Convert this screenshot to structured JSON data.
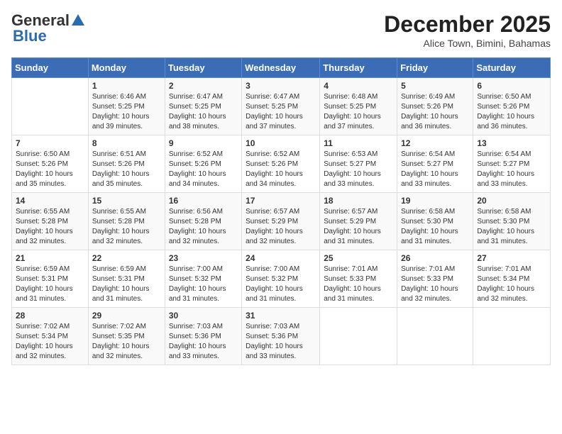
{
  "header": {
    "logo_general": "General",
    "logo_blue": "Blue",
    "month_title": "December 2025",
    "location": "Alice Town, Bimini, Bahamas"
  },
  "weekdays": [
    "Sunday",
    "Monday",
    "Tuesday",
    "Wednesday",
    "Thursday",
    "Friday",
    "Saturday"
  ],
  "weeks": [
    [
      {
        "day": "",
        "sunrise": "",
        "sunset": "",
        "daylight": ""
      },
      {
        "day": "1",
        "sunrise": "Sunrise: 6:46 AM",
        "sunset": "Sunset: 5:25 PM",
        "daylight": "Daylight: 10 hours and 39 minutes."
      },
      {
        "day": "2",
        "sunrise": "Sunrise: 6:47 AM",
        "sunset": "Sunset: 5:25 PM",
        "daylight": "Daylight: 10 hours and 38 minutes."
      },
      {
        "day": "3",
        "sunrise": "Sunrise: 6:47 AM",
        "sunset": "Sunset: 5:25 PM",
        "daylight": "Daylight: 10 hours and 37 minutes."
      },
      {
        "day": "4",
        "sunrise": "Sunrise: 6:48 AM",
        "sunset": "Sunset: 5:25 PM",
        "daylight": "Daylight: 10 hours and 37 minutes."
      },
      {
        "day": "5",
        "sunrise": "Sunrise: 6:49 AM",
        "sunset": "Sunset: 5:26 PM",
        "daylight": "Daylight: 10 hours and 36 minutes."
      },
      {
        "day": "6",
        "sunrise": "Sunrise: 6:50 AM",
        "sunset": "Sunset: 5:26 PM",
        "daylight": "Daylight: 10 hours and 36 minutes."
      }
    ],
    [
      {
        "day": "7",
        "sunrise": "Sunrise: 6:50 AM",
        "sunset": "Sunset: 5:26 PM",
        "daylight": "Daylight: 10 hours and 35 minutes."
      },
      {
        "day": "8",
        "sunrise": "Sunrise: 6:51 AM",
        "sunset": "Sunset: 5:26 PM",
        "daylight": "Daylight: 10 hours and 35 minutes."
      },
      {
        "day": "9",
        "sunrise": "Sunrise: 6:52 AM",
        "sunset": "Sunset: 5:26 PM",
        "daylight": "Daylight: 10 hours and 34 minutes."
      },
      {
        "day": "10",
        "sunrise": "Sunrise: 6:52 AM",
        "sunset": "Sunset: 5:26 PM",
        "daylight": "Daylight: 10 hours and 34 minutes."
      },
      {
        "day": "11",
        "sunrise": "Sunrise: 6:53 AM",
        "sunset": "Sunset: 5:27 PM",
        "daylight": "Daylight: 10 hours and 33 minutes."
      },
      {
        "day": "12",
        "sunrise": "Sunrise: 6:54 AM",
        "sunset": "Sunset: 5:27 PM",
        "daylight": "Daylight: 10 hours and 33 minutes."
      },
      {
        "day": "13",
        "sunrise": "Sunrise: 6:54 AM",
        "sunset": "Sunset: 5:27 PM",
        "daylight": "Daylight: 10 hours and 33 minutes."
      }
    ],
    [
      {
        "day": "14",
        "sunrise": "Sunrise: 6:55 AM",
        "sunset": "Sunset: 5:28 PM",
        "daylight": "Daylight: 10 hours and 32 minutes."
      },
      {
        "day": "15",
        "sunrise": "Sunrise: 6:55 AM",
        "sunset": "Sunset: 5:28 PM",
        "daylight": "Daylight: 10 hours and 32 minutes."
      },
      {
        "day": "16",
        "sunrise": "Sunrise: 6:56 AM",
        "sunset": "Sunset: 5:28 PM",
        "daylight": "Daylight: 10 hours and 32 minutes."
      },
      {
        "day": "17",
        "sunrise": "Sunrise: 6:57 AM",
        "sunset": "Sunset: 5:29 PM",
        "daylight": "Daylight: 10 hours and 32 minutes."
      },
      {
        "day": "18",
        "sunrise": "Sunrise: 6:57 AM",
        "sunset": "Sunset: 5:29 PM",
        "daylight": "Daylight: 10 hours and 31 minutes."
      },
      {
        "day": "19",
        "sunrise": "Sunrise: 6:58 AM",
        "sunset": "Sunset: 5:30 PM",
        "daylight": "Daylight: 10 hours and 31 minutes."
      },
      {
        "day": "20",
        "sunrise": "Sunrise: 6:58 AM",
        "sunset": "Sunset: 5:30 PM",
        "daylight": "Daylight: 10 hours and 31 minutes."
      }
    ],
    [
      {
        "day": "21",
        "sunrise": "Sunrise: 6:59 AM",
        "sunset": "Sunset: 5:31 PM",
        "daylight": "Daylight: 10 hours and 31 minutes."
      },
      {
        "day": "22",
        "sunrise": "Sunrise: 6:59 AM",
        "sunset": "Sunset: 5:31 PM",
        "daylight": "Daylight: 10 hours and 31 minutes."
      },
      {
        "day": "23",
        "sunrise": "Sunrise: 7:00 AM",
        "sunset": "Sunset: 5:32 PM",
        "daylight": "Daylight: 10 hours and 31 minutes."
      },
      {
        "day": "24",
        "sunrise": "Sunrise: 7:00 AM",
        "sunset": "Sunset: 5:32 PM",
        "daylight": "Daylight: 10 hours and 31 minutes."
      },
      {
        "day": "25",
        "sunrise": "Sunrise: 7:01 AM",
        "sunset": "Sunset: 5:33 PM",
        "daylight": "Daylight: 10 hours and 31 minutes."
      },
      {
        "day": "26",
        "sunrise": "Sunrise: 7:01 AM",
        "sunset": "Sunset: 5:33 PM",
        "daylight": "Daylight: 10 hours and 32 minutes."
      },
      {
        "day": "27",
        "sunrise": "Sunrise: 7:01 AM",
        "sunset": "Sunset: 5:34 PM",
        "daylight": "Daylight: 10 hours and 32 minutes."
      }
    ],
    [
      {
        "day": "28",
        "sunrise": "Sunrise: 7:02 AM",
        "sunset": "Sunset: 5:34 PM",
        "daylight": "Daylight: 10 hours and 32 minutes."
      },
      {
        "day": "29",
        "sunrise": "Sunrise: 7:02 AM",
        "sunset": "Sunset: 5:35 PM",
        "daylight": "Daylight: 10 hours and 32 minutes."
      },
      {
        "day": "30",
        "sunrise": "Sunrise: 7:03 AM",
        "sunset": "Sunset: 5:36 PM",
        "daylight": "Daylight: 10 hours and 33 minutes."
      },
      {
        "day": "31",
        "sunrise": "Sunrise: 7:03 AM",
        "sunset": "Sunset: 5:36 PM",
        "daylight": "Daylight: 10 hours and 33 minutes."
      },
      {
        "day": "",
        "sunrise": "",
        "sunset": "",
        "daylight": ""
      },
      {
        "day": "",
        "sunrise": "",
        "sunset": "",
        "daylight": ""
      },
      {
        "day": "",
        "sunrise": "",
        "sunset": "",
        "daylight": ""
      }
    ]
  ]
}
